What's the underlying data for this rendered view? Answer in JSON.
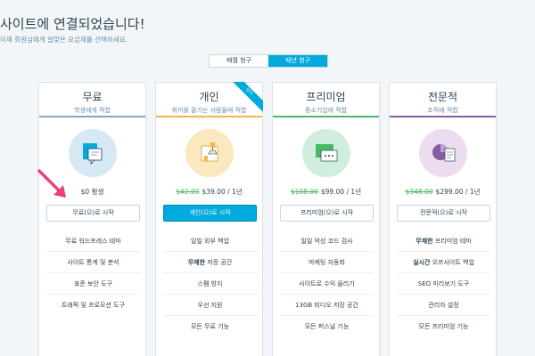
{
  "header": {
    "title": "사이트에 연결되었습니다!",
    "subtitle": "이제 회원님에게 알맞은 요금제를 선택하세요."
  },
  "billing_toggle": {
    "monthly": "매월 청구",
    "yearly": "매년 청구",
    "active": "yearly"
  },
  "colors": {
    "accent": "#00aadc",
    "free": "#87a6bc",
    "personal": "#f0b849",
    "premium": "#4ab866",
    "business": "#855da6"
  },
  "plans": [
    {
      "name": "무료",
      "subtitle": "학생에게 적합",
      "icon": "chat-bubbles-icon",
      "price_old": "",
      "price": "$0 평생",
      "cta": "무료(으)로 시작",
      "features": [
        "무료 워드프레스 테마",
        "사이트 통계 및 분석",
        "표준 보안 도구",
        "트래픽 및 프로모션 도구"
      ]
    },
    {
      "name": "개인",
      "subtitle": "취미를 즐기는 사람들에 적합",
      "badge": "인기",
      "icon": "lamp-icon",
      "price_old": "$42.00",
      "price": "$39.00 / 1년",
      "cta": "개인(으)로 시작",
      "features": [
        "일일 외부 백업",
        "무제한 저장 공간",
        "스팸 방지",
        "우선 지원",
        "모든 무료 기능"
      ]
    },
    {
      "name": "프리미엄",
      "subtitle": "중소기업에 적합",
      "icon": "monitor-icon",
      "price_old": "$108.00",
      "price": "$99.00 / 1년",
      "cta": "프리미엄(으)로 시작",
      "features": [
        "일일 악성 코드 검사",
        "마케팅 자동화",
        "사이트로 수익 올리기",
        "13GB 비디오 저장 공간",
        "모든 퍼스널 기능"
      ]
    },
    {
      "name": "전문적",
      "subtitle": "조직에 적합",
      "icon": "chart-icon",
      "price_old": "$348.00",
      "price": "$299.00 / 1년",
      "cta": "전문적(으)로 시작",
      "features_bold": [
        "무제한",
        "실시간",
        "",
        "",
        ""
      ],
      "features": [
        " 프리미엄 테마",
        " 오프사이트 백업",
        "SEO 미리보기 도구",
        "관리자 설정",
        "모든 프리미엄 기능"
      ]
    }
  ]
}
